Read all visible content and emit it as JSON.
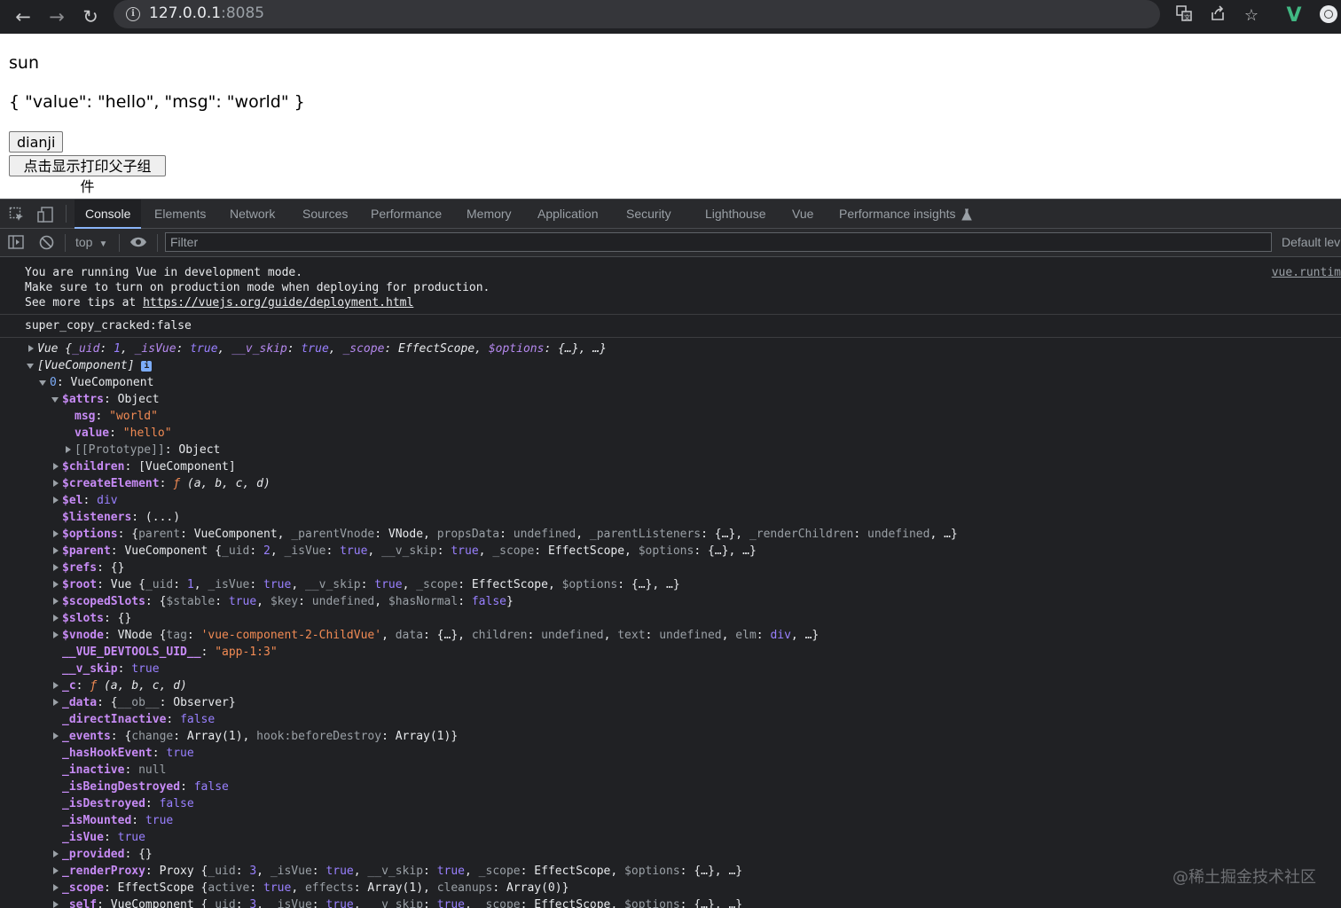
{
  "browser": {
    "url_host": "127.0.0.1",
    "url_port": ":8085"
  },
  "page": {
    "line1": "sun",
    "line2": "{ \"value\": \"hello\", \"msg\": \"world\" }",
    "button1": "dianji",
    "button2": "点击显示打印父子组件"
  },
  "devtools": {
    "tabs": [
      "Console",
      "Elements",
      "Network",
      "Sources",
      "Performance",
      "Memory",
      "Application",
      "Security",
      "Lighthouse",
      "Vue",
      "Performance insights"
    ],
    "context": "top",
    "filter_placeholder": "Filter",
    "levels": "Default lev"
  },
  "console": {
    "vue_msg": [
      "You are running Vue in development mode.",
      "Make sure to turn on production mode when deploying for production.",
      "See more tips at "
    ],
    "vue_msg_link": "https://vuejs.org/guide/deployment.html",
    "vue_msg_source": "vue.runtim",
    "log2": "super_copy_cracked:false"
  },
  "watermark": "@稀土掘金技术社区"
}
